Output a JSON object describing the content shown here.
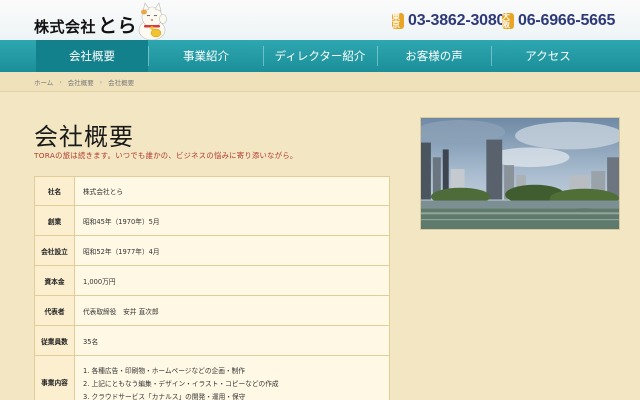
{
  "header": {
    "logo_main": "株式会社",
    "logo_big": "とら",
    "phones": [
      {
        "tag": "東京",
        "number": "03-3862-3080"
      },
      {
        "tag": "大阪",
        "number": "06-6966-5665"
      }
    ]
  },
  "nav": {
    "items": [
      {
        "label": "会社概要"
      },
      {
        "label": "事業紹介"
      },
      {
        "label": "ディレクター紹介"
      },
      {
        "label": "お客様の声"
      },
      {
        "label": "アクセス"
      }
    ]
  },
  "breadcrumb": {
    "items": [
      "ホーム",
      "会社概要",
      "会社概要"
    ]
  },
  "main": {
    "title": "会社概要",
    "lead": "TORAの旅は続きます。いつでも誰かの、ビジネスの悩みに寄り添いながら。",
    "table": [
      {
        "label": "社名",
        "value": "株式会社とら"
      },
      {
        "label": "創業",
        "value": "昭和45年（1970年）5月"
      },
      {
        "label": "会社設立",
        "value": "昭和52年（1977年）4月"
      },
      {
        "label": "資本金",
        "value": "1,000万円"
      },
      {
        "label": "代表者",
        "value": "代表取締役　安井 直次郎"
      },
      {
        "label": "従業員数",
        "value": "35名"
      },
      {
        "label": "事業内容",
        "list": [
          "1. 各種広告・印刷物・ホームページなどの企画・制作",
          "2. 上記にともなう編集・デザイン・イラスト・コピーなどの作成",
          "3. クラウドサービス「カナルス」の開発・運用・保守"
        ]
      }
    ]
  },
  "colors": {
    "nav": "#1a8f99",
    "nav_active": "#13818b",
    "lead": "#b03a2e",
    "phone": "#2e3a78",
    "phone_tag": "#e9a626",
    "background": "#f3e6c2"
  }
}
